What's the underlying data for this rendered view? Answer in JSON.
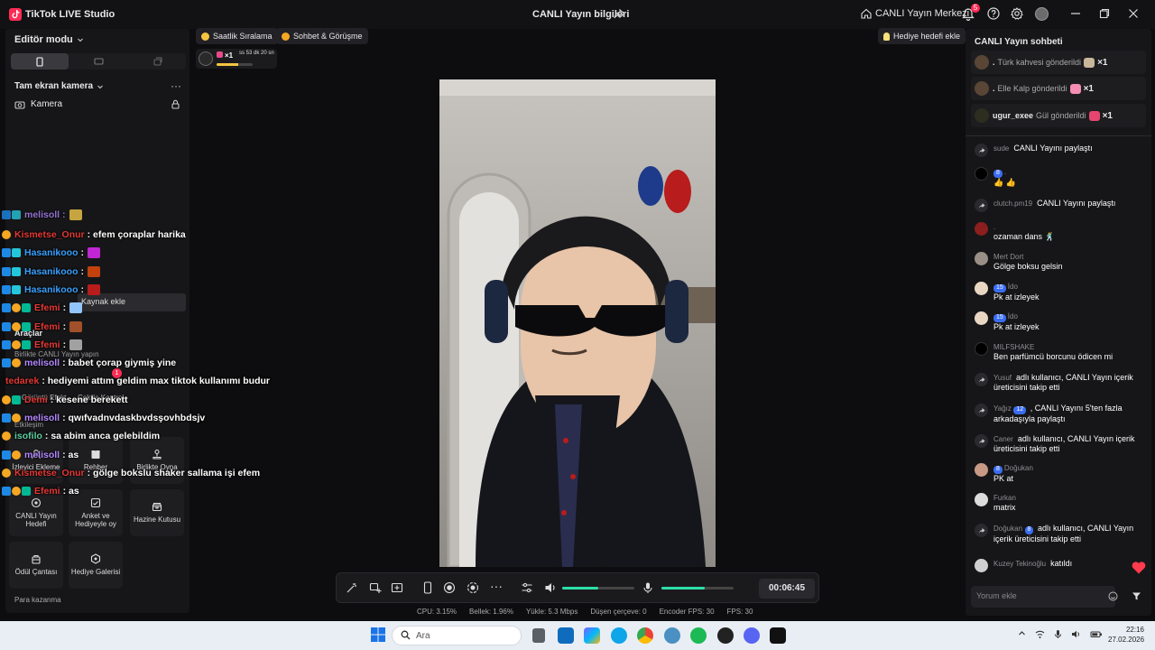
{
  "window": {
    "app_title": "TikTok LIVE Studio",
    "live_info": "CANLI Yayın bilgileri",
    "center_label": "CANLI Yayın Merkezi",
    "notification_count": "5"
  },
  "left": {
    "editor_mode": "Editör modu",
    "scene": "Tam ekran kamera",
    "camera": "Kamera",
    "add_source": "Kaynak ekle",
    "tools": "Araçlar",
    "collab": "Birlikte CANLI Yayın yapın",
    "interaction": "Etkileşim",
    "money": "Para kazanma",
    "tool_cards": [
      {
        "label": "İzleyici Ekleme"
      },
      {
        "label": "Rehber"
      },
      {
        "label": "Birlikte Oyna"
      },
      {
        "label": "CANLI Yayın Hedefi"
      },
      {
        "label": "Anket ve Hediyeyle oy"
      },
      {
        "label": "Hazine Kutusu"
      },
      {
        "label": "Ödül Çantası"
      },
      {
        "label": "Hediye Galerisi"
      }
    ],
    "partial_items": [
      "Görüntü Efekt",
      "Çekiliş Kontrol"
    ],
    "badge": "1"
  },
  "overlay_chat": [
    {
      "user": "Kismetse_Onur",
      "msg": ": efem çoraplar harika",
      "color": "#e53935"
    },
    {
      "user": "Hasanikooo",
      "msg": ":",
      "color": "#3aa0ff"
    },
    {
      "user": "Hasanikooo",
      "msg": ":",
      "color": "#3aa0ff"
    },
    {
      "user": "Hasanikooo",
      "msg": ":",
      "color": "#3aa0ff"
    },
    {
      "user": "Efemi",
      "msg": ":",
      "color": "#e53935"
    },
    {
      "user": "Efemi",
      "msg": ":",
      "color": "#e53935"
    },
    {
      "user": "Efemi",
      "msg": ":",
      "color": "#e53935"
    },
    {
      "user": "melisoll",
      "msg": ": babet çorap giymiş yine",
      "color": "#b388ff"
    },
    {
      "user": "tedarek",
      "msg": ": hediyemi attım geldim max tiktok kullanımı budur",
      "color": "#e53935"
    },
    {
      "user": "Demi",
      "msg": ": kesene berekett",
      "color": "#e53935"
    },
    {
      "user": "melisoll",
      "msg": ": qwıfvadnvdaskbvdsşovhbdsjv",
      "color": "#b388ff"
    },
    {
      "user": "isofilo",
      "msg": ": sa abim anca gelebildim",
      "color": "#5fd0a0"
    },
    {
      "user": "melisoll",
      "msg": ": as",
      "color": "#b388ff"
    },
    {
      "user": "Kismetse_Onur",
      "msg": ": gölge bokslu shaker sallama işi efem",
      "color": "#e53935"
    },
    {
      "user": "Efemi",
      "msg": ": as",
      "color": "#e53935"
    }
  ],
  "center": {
    "chip_rank": "Saatlik Sıralama",
    "chip_chat": "Sohbet & Görüşme",
    "gift_goal": "Hediye hedefi ekle",
    "mini_gift": "×1",
    "mini_timer": "ss 53 dk 20 sn",
    "mini_progress": 0.6,
    "timer": "00:06:45",
    "volume_speaker": 0.5,
    "volume_mic": 0.6
  },
  "stats": {
    "cpu": "CPU: 3.15%",
    "memory": "Bellek: 1.96%",
    "upload": "Yükle: 5.3 Mbps",
    "dropped": "Düşen çerçeve: 0",
    "encoder": "Encoder FPS: 30",
    "fps": "FPS: 30"
  },
  "right": {
    "title": "CANLI Yayın sohbeti",
    "gifts": [
      {
        "user": ".",
        "text": "Türk kahvesi gönderildi",
        "count": "×1"
      },
      {
        "user": ".",
        "text": "Elle Kalp gönderildi",
        "count": "×1"
      },
      {
        "user": "ugur_exee",
        "text": "Gül gönderildi",
        "count": "×1"
      }
    ],
    "comments": [
      {
        "name": "sude",
        "text": "CANLI Yayını paylaştı"
      },
      {
        "level": "8",
        "name": ".",
        "text": "👍 👍"
      },
      {
        "name": "clutch.pm19",
        "text": "CANLI Yayını paylaştı"
      },
      {
        "name": ".",
        "text": "ozaman dans 🕺"
      },
      {
        "name": "Mert Dort",
        "text": "Gölge boksu gelsin"
      },
      {
        "level": "15",
        "name": "İdo",
        "text": "Pk at izleyek"
      },
      {
        "level": "15",
        "name": "İdo",
        "text": "Pk at izleyek"
      },
      {
        "name": "MILFSHAKE",
        "text": "Ben parfümcü borcunu ödicen mi"
      },
      {
        "name": "Yusuf",
        "text": "adlı kullanıcı, CANLI Yayın içerik üreticisini takip etti"
      },
      {
        "name": "Yağız",
        "level": "12",
        "text": ", CANLI Yayını 5'ten fazla arkadaşıyla paylaştı"
      },
      {
        "name": "Caner",
        "text": "adlı kullanıcı, CANLI Yayın içerik üreticisini takip etti"
      },
      {
        "level": "8",
        "name": "Doğukan",
        "text": "PK at"
      },
      {
        "name": "Furkan",
        "text": "matrix"
      },
      {
        "name": "Doğukan",
        "level": "8",
        "text": "adlı kullanıcı, CANLI Yayın içerik üreticisini takip etti"
      },
      {
        "name": "Kuzey Tekinoğlu",
        "text": "katıldı"
      }
    ],
    "comment_placeholder": "Yorum ekle"
  },
  "taskbar": {
    "search": "Ara",
    "time": "22:16",
    "date": "27.02.2026"
  }
}
